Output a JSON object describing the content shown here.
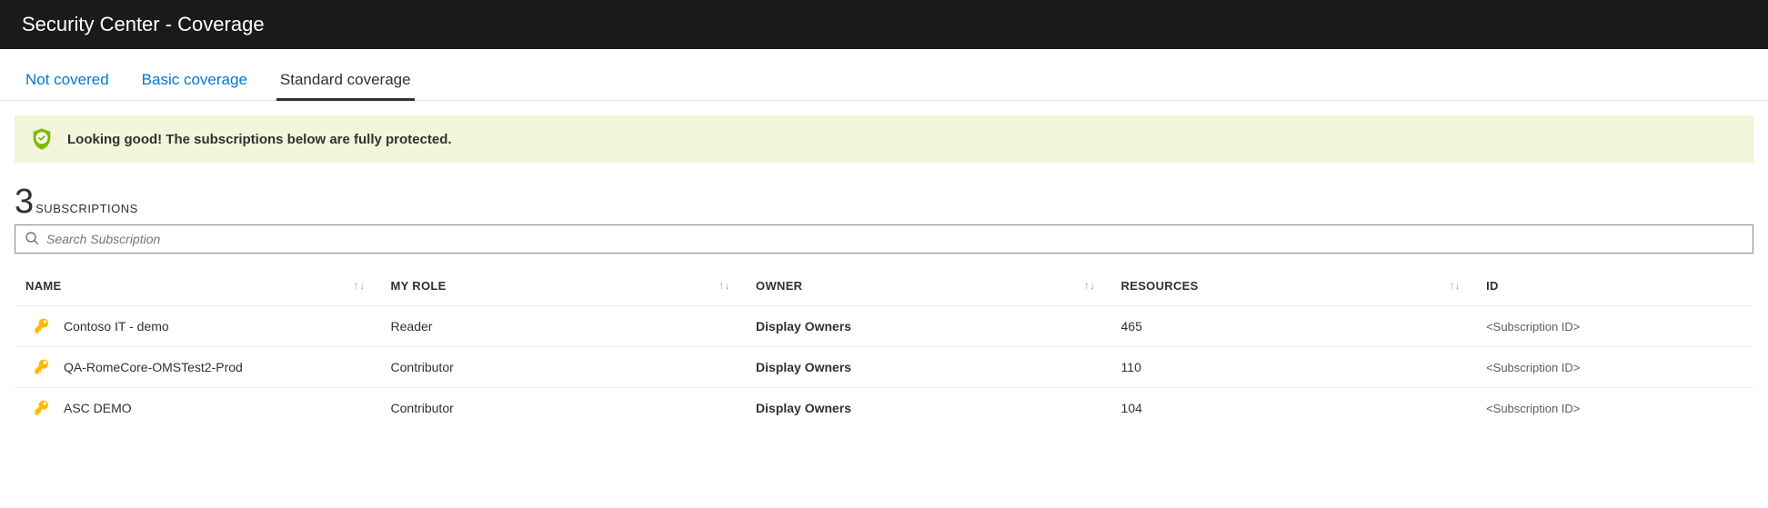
{
  "title": "Security Center - Coverage",
  "tabs": [
    {
      "label": "Not covered",
      "active": false
    },
    {
      "label": "Basic coverage",
      "active": false
    },
    {
      "label": "Standard coverage",
      "active": true
    }
  ],
  "banner": {
    "text": "Looking good! The subscriptions below are fully protected."
  },
  "count": {
    "value": "3",
    "label": "SUBSCRIPTIONS"
  },
  "search": {
    "placeholder": "Search Subscription"
  },
  "columns": {
    "name": "NAME",
    "role": "MY ROLE",
    "owner": "OWNER",
    "resources": "RESOURCES",
    "id": "ID"
  },
  "rows": [
    {
      "name": "Contoso IT - demo",
      "role": "Reader",
      "owner": "Display Owners",
      "resources": "465",
      "id": "<Subscription ID>"
    },
    {
      "name": "QA-RomeCore-OMSTest2-Prod",
      "role": "Contributor",
      "owner": "Display Owners",
      "resources": "110",
      "id": "<Subscription ID>"
    },
    {
      "name": "ASC DEMO",
      "role": "Contributor",
      "owner": "Display Owners",
      "resources": "104",
      "id": "<Subscription ID>"
    }
  ]
}
